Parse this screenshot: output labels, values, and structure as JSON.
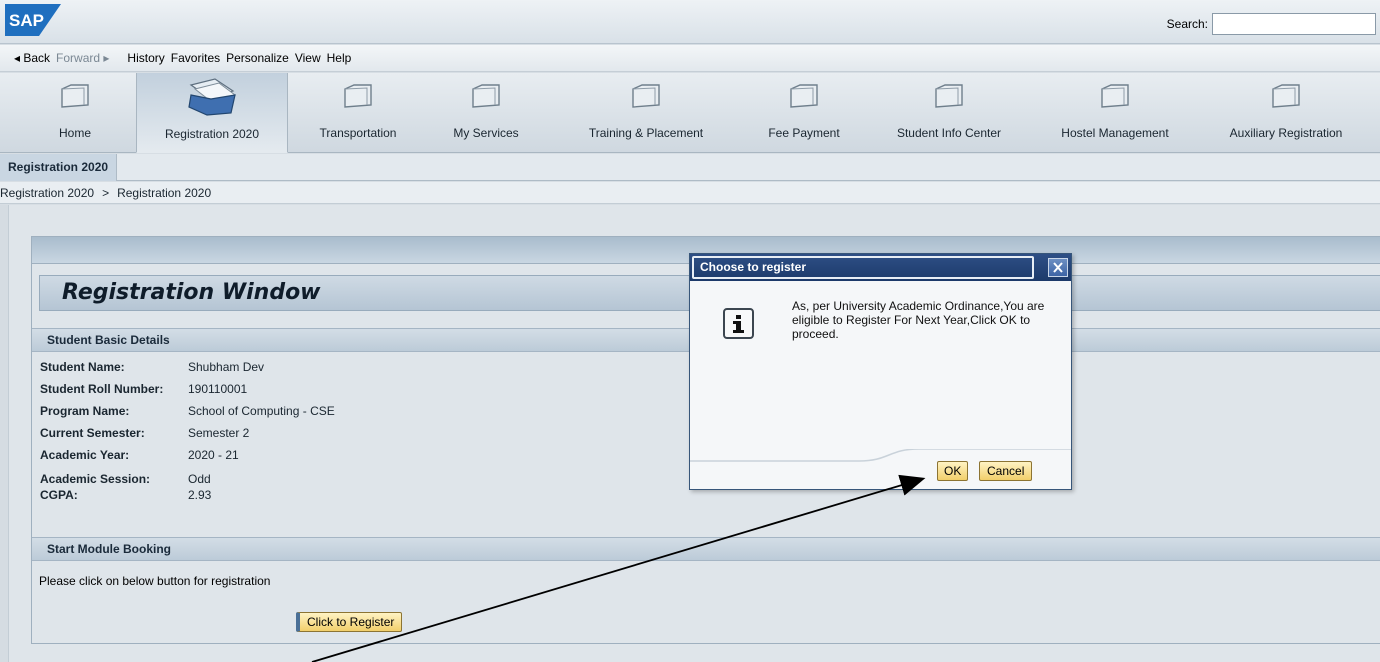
{
  "header": {
    "logo_text": "SAP",
    "search_label": "Search:",
    "search_value": ""
  },
  "menubar": {
    "back": "◂ Back",
    "forward": "Forward ▸",
    "items": [
      "History",
      "Favorites",
      "Personalize",
      "View",
      "Help"
    ]
  },
  "nav": {
    "tabs": [
      {
        "label": "Home",
        "active": false
      },
      {
        "label": "Registration 2020",
        "active": true
      },
      {
        "label": "Transportation",
        "active": false
      },
      {
        "label": "My Services",
        "active": false
      },
      {
        "label": "Training & Placement",
        "active": false
      },
      {
        "label": "Fee Payment",
        "active": false
      },
      {
        "label": "Student Info Center",
        "active": false
      },
      {
        "label": "Hostel Management",
        "active": false
      },
      {
        "label": "Auxiliary Registration",
        "active": false
      }
    ]
  },
  "subnav": {
    "active_tab": "Registration 2020"
  },
  "breadcrumb": {
    "items": [
      "Registration 2020",
      "Registration 2020"
    ],
    "separator": ">"
  },
  "page": {
    "title": "Registration Window",
    "basic_details_header": "Student Basic Details",
    "details": [
      {
        "label": "Student Name:",
        "value": "Shubham Dev"
      },
      {
        "label": "Student Roll Number:",
        "value": "190110001"
      },
      {
        "label": "Program Name:",
        "value": "School of Computing - CSE"
      },
      {
        "label": "Current Semester:",
        "value": "Semester 2"
      },
      {
        "label": "Academic Year:",
        "value": "2020 - 21"
      },
      {
        "label": "Academic Session:",
        "value": "Odd"
      },
      {
        "label": "CGPA:",
        "value": "2.93"
      }
    ],
    "module_header": "Start Module Booking",
    "module_text": "Please click on below button for registration",
    "register_button": "Click to Register"
  },
  "dialog": {
    "title": "Choose to register",
    "message": "As, per University Academic Ordinance,You are eligible to Register For Next Year,Click OK to proceed.",
    "ok_label": "OK",
    "cancel_label": "Cancel"
  },
  "colors": {
    "dialog_title_bg": "#1c3a6a",
    "button_bg": "#f2cf6b",
    "section_header_bg": "#bccbd8"
  }
}
